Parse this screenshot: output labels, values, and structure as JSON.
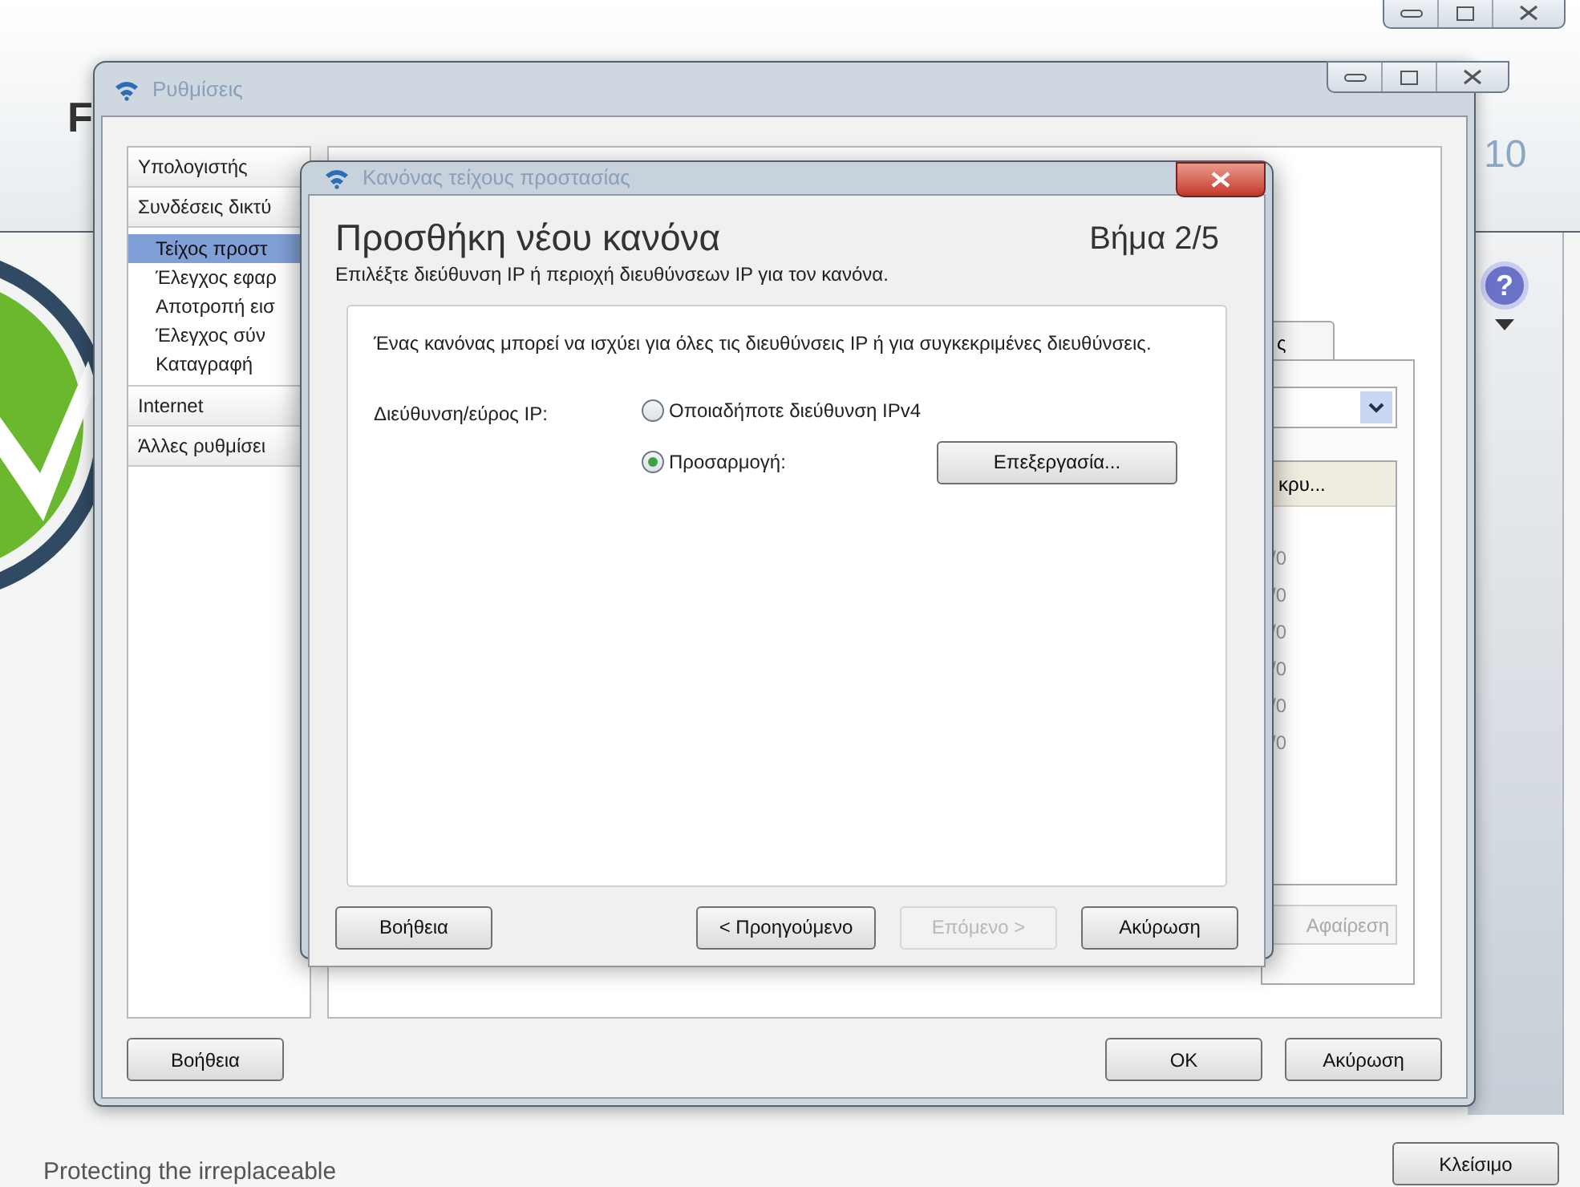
{
  "background_app": {
    "brand_fragments": [
      "F",
      "10"
    ],
    "help_glyph": "?",
    "tagline": "Protecting the irreplaceable",
    "close_button": "Κλείσιμο"
  },
  "settings_window": {
    "title": "Ρυθμίσεις",
    "sidebar": [
      {
        "label": "Υπολογιστής",
        "selected": false
      },
      {
        "label": "Συνδέσεις δικτύ",
        "selected": false,
        "children": [
          {
            "label": "Τείχος προστ",
            "selected": true
          },
          {
            "label": "Έλεγχος εφαρ",
            "selected": false
          },
          {
            "label": "Αποτροπή εισ",
            "selected": false
          },
          {
            "label": "Έλεγχος σύν",
            "selected": false
          },
          {
            "label": "Καταγραφή",
            "selected": false
          }
        ]
      },
      {
        "label": "Internet",
        "selected": false
      },
      {
        "label": "Άλλες ρυθμίσει",
        "selected": false
      }
    ],
    "panel": {
      "tab": "ς",
      "list_header": "κρυ...",
      "rows": [
        "/0",
        "/0",
        "/0",
        "/0",
        "/0",
        "/0"
      ],
      "remove_button": "Αφαίρεση"
    },
    "buttons": [
      {
        "label": "Βοήθεια"
      },
      {
        "label": "OK"
      },
      {
        "label": "Ακύρωση"
      }
    ]
  },
  "dialog": {
    "title": "Κανόνας τείχους προστασίας",
    "heading": "Προσθήκη νέου κανόνα",
    "step": "Βήμα 2/5",
    "subtitle": "Επιλέξτε διεύθυνση IP ή περιοχή διευθύνσεων IP για τον κανόνα.",
    "description": "Ένας κανόνας μπορεί να ισχύει για όλες τις διευθύνσεις IP ή για συγκεκριμένες διευθύνσεις.",
    "field_label": "Διεύθυνση/εύρος IP:",
    "options": [
      {
        "label": "Οποιαδήποτε διεύθυνση IPv4",
        "selected": false
      },
      {
        "label": "Προσαρμογή:",
        "selected": true,
        "button": "Επεξεργασία..."
      }
    ],
    "buttons": [
      {
        "label": "Βοήθεια",
        "disabled": false
      },
      {
        "label": "< Προηγούμενο",
        "disabled": false
      },
      {
        "label": "Επόμενο >",
        "disabled": true
      },
      {
        "label": "Ακύρωση",
        "disabled": false
      }
    ]
  }
}
